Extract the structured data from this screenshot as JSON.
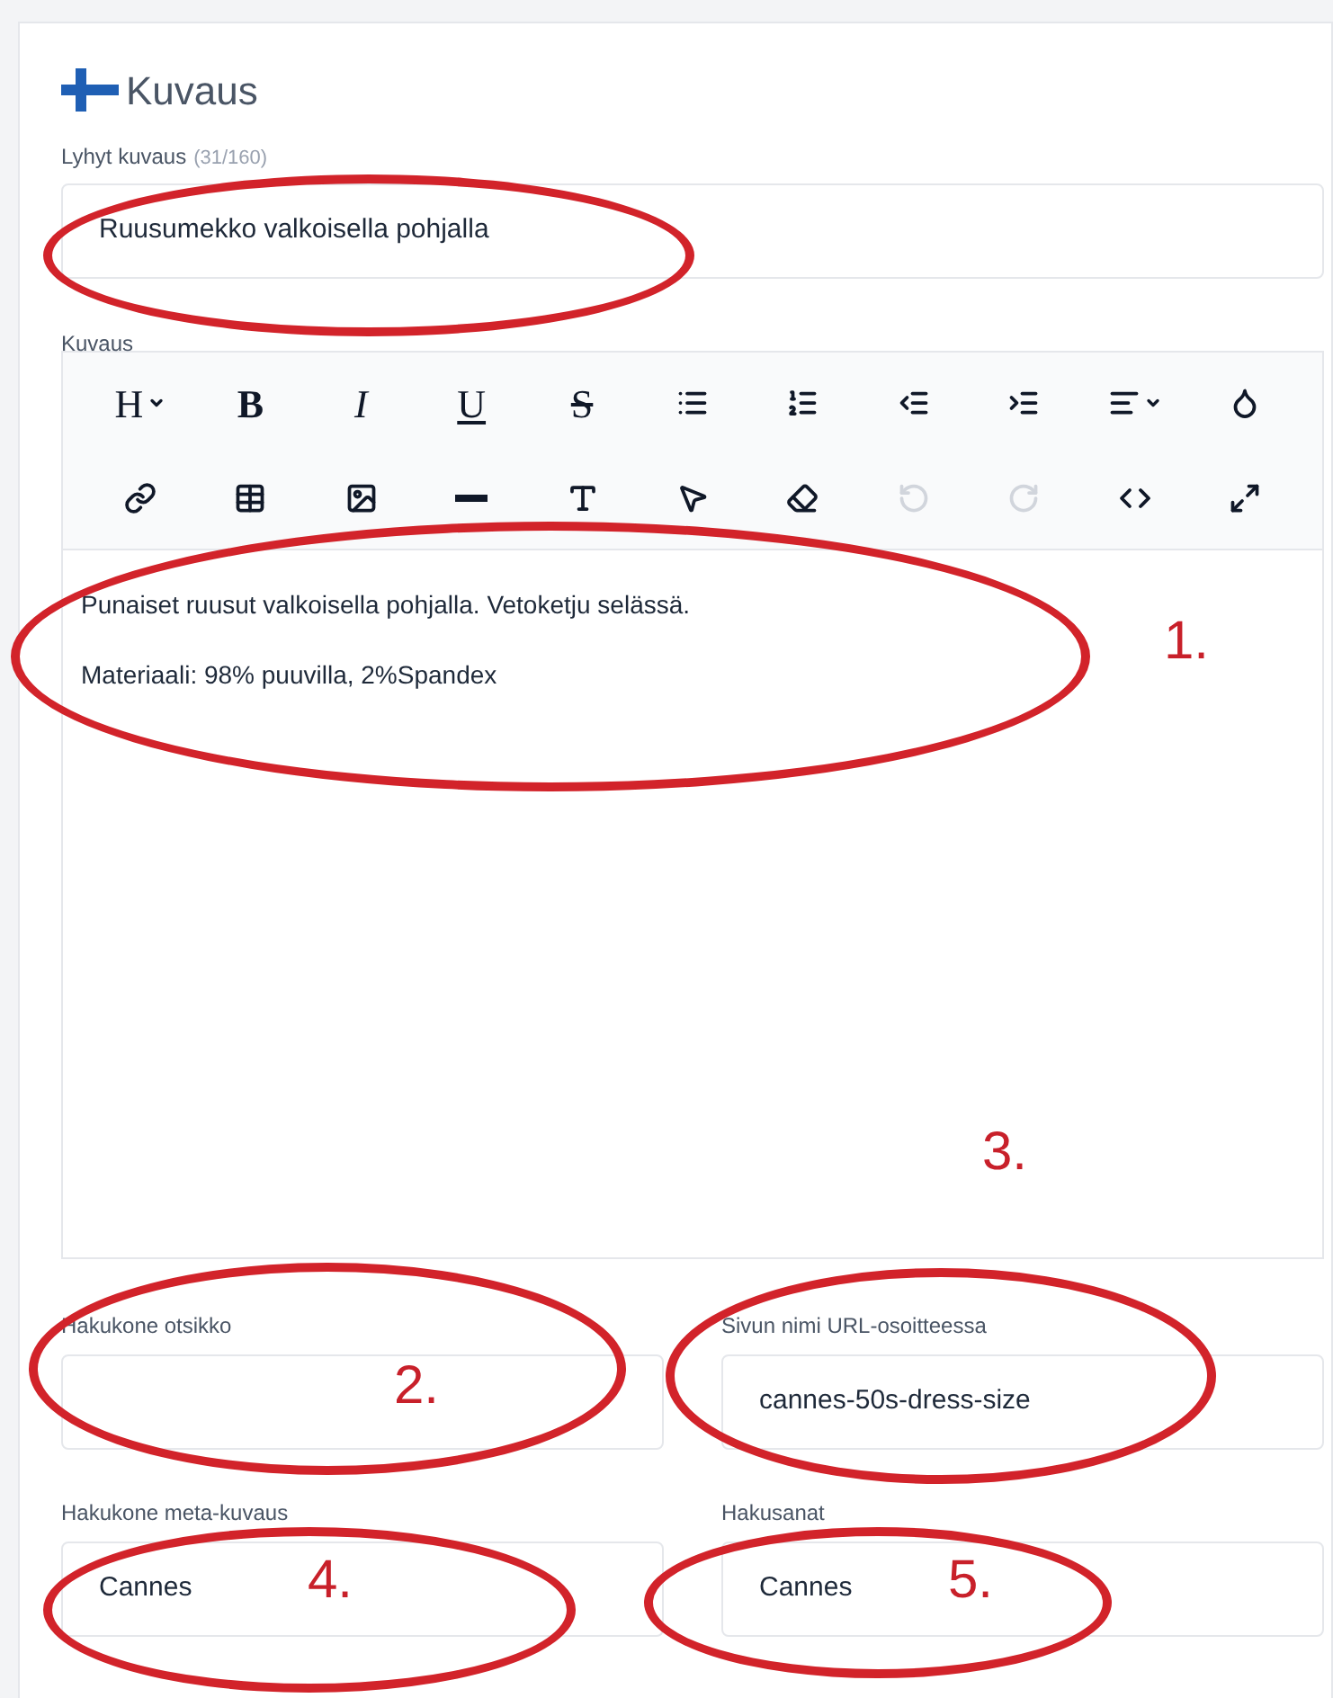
{
  "section": {
    "title": "Kuvaus"
  },
  "short_description": {
    "label": "Lyhyt kuvaus",
    "count": "(31/160)",
    "value": "Ruusumekko valkoisella pohjalla"
  },
  "editor": {
    "label": "Kuvaus",
    "toolbar_rows": [
      [
        {
          "kind": "heading",
          "label": "H",
          "disabled": false
        },
        {
          "kind": "bold",
          "label": "B",
          "disabled": false
        },
        {
          "kind": "italic",
          "label": "I",
          "disabled": false
        },
        {
          "kind": "underline",
          "label": "U",
          "disabled": false
        },
        {
          "kind": "strike",
          "label": "S",
          "disabled": false
        },
        {
          "kind": "bullets",
          "disabled": false
        },
        {
          "kind": "numbers",
          "disabled": false
        },
        {
          "kind": "outdent",
          "disabled": false
        },
        {
          "kind": "indent",
          "disabled": false
        },
        {
          "kind": "align",
          "disabled": false
        },
        {
          "kind": "color",
          "disabled": false
        }
      ],
      [
        {
          "kind": "link",
          "disabled": false
        },
        {
          "kind": "table",
          "disabled": false
        },
        {
          "kind": "image",
          "disabled": false
        },
        {
          "kind": "rule",
          "disabled": false
        },
        {
          "kind": "textsize",
          "disabled": false
        },
        {
          "kind": "pointer",
          "disabled": false
        },
        {
          "kind": "eraser",
          "disabled": false
        },
        {
          "kind": "undo",
          "disabled": true
        },
        {
          "kind": "redo",
          "disabled": true
        },
        {
          "kind": "code",
          "disabled": false
        },
        {
          "kind": "fullscreen",
          "disabled": false
        }
      ]
    ],
    "paragraphs": [
      "Punaiset ruusut valkoisella pohjalla. Vetoketju selässä.",
      "Materiaali: 98% puuvilla, 2%Spandex"
    ]
  },
  "seo_fields": [
    {
      "label": "Hakukone otsikko"
    },
    {
      "label": "Sivun nimi URL-osoitteessa",
      "value": "cannes-50s-dress-size"
    },
    {
      "label": "Hakukone meta-kuvaus",
      "value": "Cannes"
    },
    {
      "label": "Hakusanat",
      "value": "Cannes"
    }
  ],
  "annotations": [
    "1.",
    "2.",
    "3.",
    "4.",
    "5."
  ]
}
